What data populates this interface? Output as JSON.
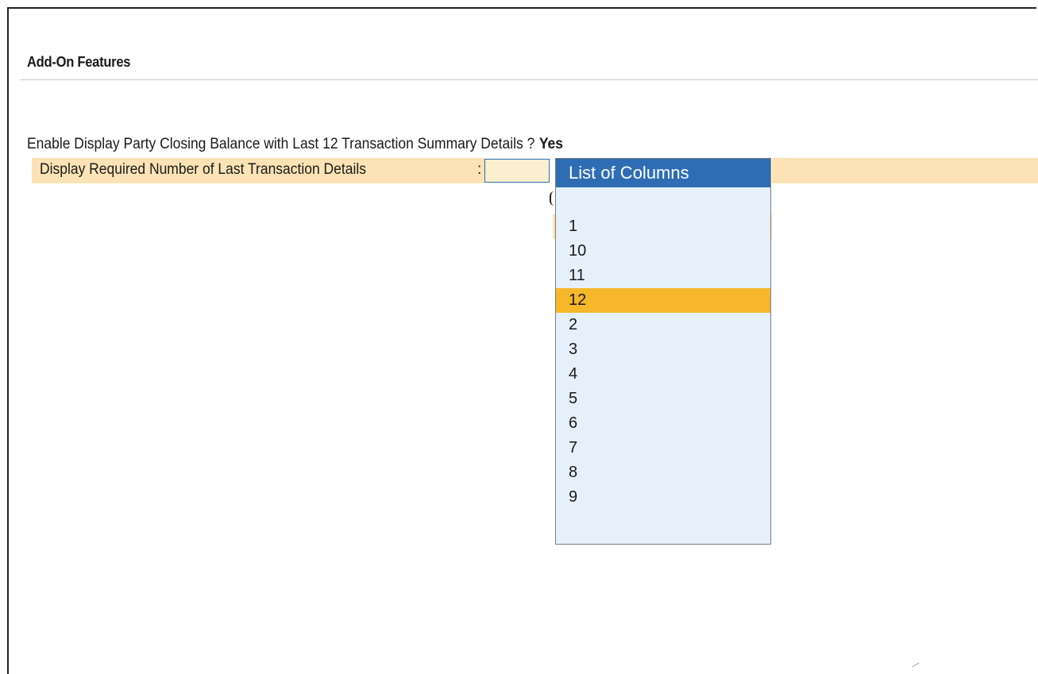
{
  "header": {
    "section_title": "Add-On Features"
  },
  "form": {
    "question_label": "Enable Display Party Closing Balance with Last 12 Transaction Summary Details ?",
    "question_answer": "Yes",
    "field_label": "Display Required Number of Last Transaction Details",
    "field_separator": ":",
    "field_value": ""
  },
  "dropdown": {
    "title": "List of Columns",
    "selected_value": "12",
    "items": [
      "1",
      "10",
      "11",
      "12",
      "2",
      "3",
      "4",
      "5",
      "6",
      "7",
      "8",
      "9"
    ]
  },
  "colors": {
    "header_blue": "#2e6db4",
    "list_background": "#e6f0fb",
    "selected_highlight": "#f6b72b",
    "field_band": "#fbe3b5"
  }
}
